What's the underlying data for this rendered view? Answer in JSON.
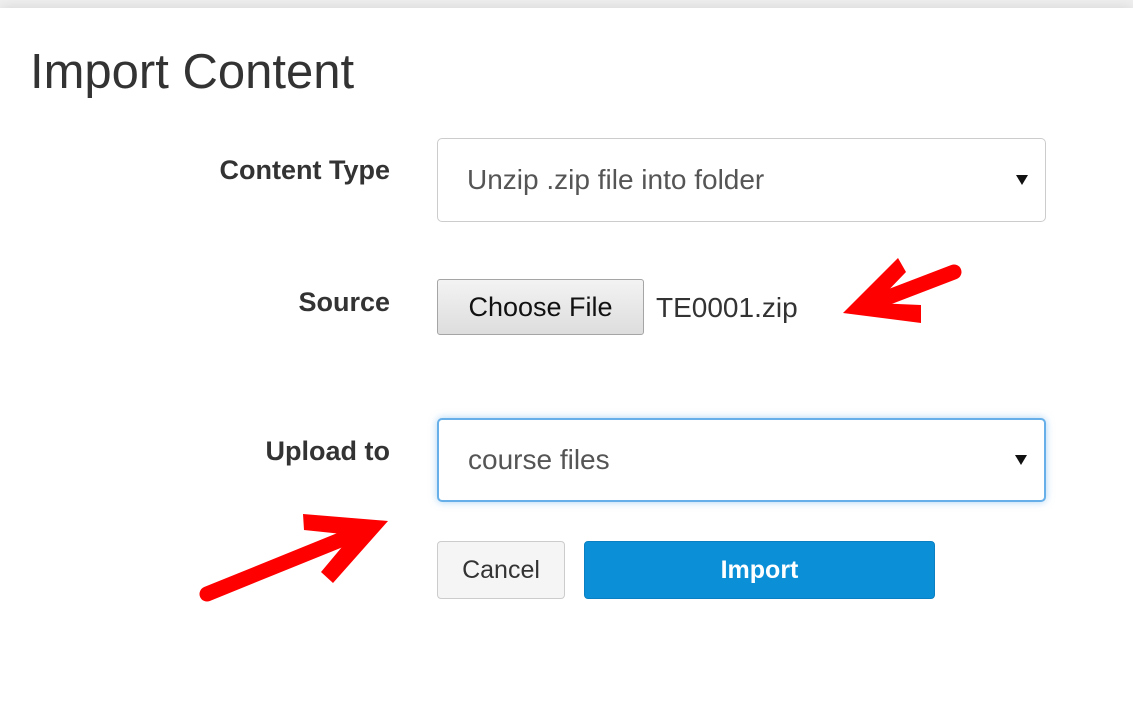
{
  "dialog": {
    "title": "Import Content"
  },
  "form": {
    "content_type": {
      "label": "Content Type",
      "selected": "Unzip .zip file into folder"
    },
    "source": {
      "label": "Source",
      "button_label": "Choose File",
      "file_name": "TE0001.zip"
    },
    "upload_to": {
      "label": "Upload to",
      "selected": "course files"
    }
  },
  "actions": {
    "cancel_label": "Cancel",
    "import_label": "Import"
  },
  "colors": {
    "import_button": "#0b90d8",
    "focus_border": "#66afe9",
    "annotation_arrow": "#ff0000"
  },
  "annotations": {
    "arrow_icons": [
      "arrow-pointing-to-file-name",
      "arrow-pointing-to-upload-select"
    ]
  }
}
